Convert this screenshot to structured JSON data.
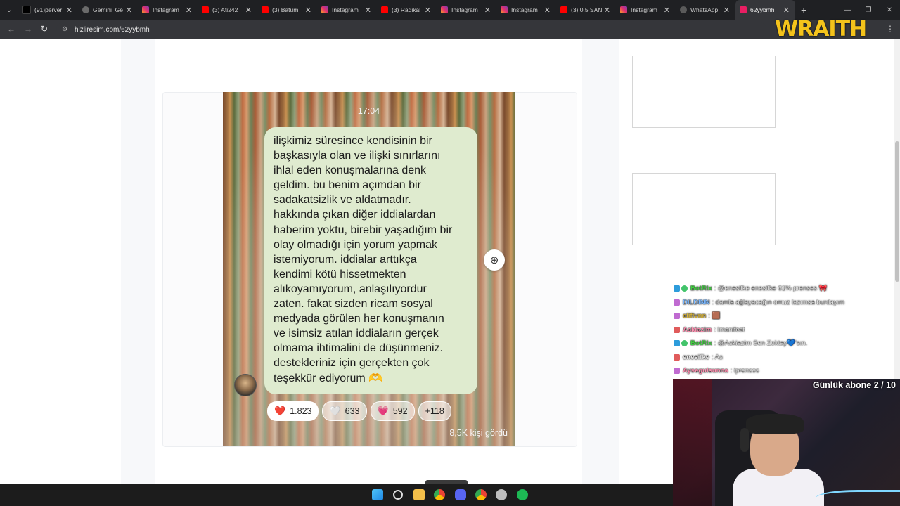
{
  "tabs": [
    {
      "label": "(91)perver",
      "icon": "tiktok-icon"
    },
    {
      "label": "Gemini_Ge",
      "icon": "globe-icon"
    },
    {
      "label": "Instagram",
      "icon": "instagram-icon"
    },
    {
      "label": "(3) Ati242",
      "icon": "youtube-icon"
    },
    {
      "label": "(3) Batum",
      "icon": "youtube-icon"
    },
    {
      "label": "Instagram",
      "icon": "instagram-icon"
    },
    {
      "label": "(3) Radikal",
      "icon": "youtube-icon"
    },
    {
      "label": "Instagram",
      "icon": "instagram-icon"
    },
    {
      "label": "Instagram",
      "icon": "instagram-icon"
    },
    {
      "label": "(3) 0.5 SAN",
      "icon": "youtube-icon"
    },
    {
      "label": "Instagram",
      "icon": "instagram-icon"
    },
    {
      "label": "WhatsApp",
      "icon": "whatsapp-icon"
    },
    {
      "label": "62yybmh",
      "icon": "hizliresim-icon",
      "active": true
    }
  ],
  "address_bar": {
    "url": "hizliresim.com/62yybmh"
  },
  "overlay_logo": {
    "text": "WRAITH"
  },
  "story": {
    "time": "17:04",
    "message_lines": [
      "ilişkimiz süresince kendisinin bir",
      "başkasıyla olan ve ilişki sınırlarını",
      "ihlal eden konuşmalarına denk",
      "geldim. bu benim açımdan bir",
      "sadakatsizlik ve aldatmadır.",
      "hakkında çıkan diğer iddialardan",
      "haberim yoktu, birebir yaşadığım bir",
      "olay olmadığı için yorum yapmak",
      "istemiyorum. iddialar arttıkça",
      "kendimi kötü hissetmekten",
      "alıkoyamıyorum, anlaşılıyordur",
      "zaten. fakat sizden ricam sosyal",
      "medyada görülen her konuşmanın",
      "ve isimsiz atılan iddiaların gerçek",
      "olmama ihtimalini de düşünmeniz.",
      "destekleriniz için gerçekten çok",
      "teşekkür ediyorum 🫶"
    ],
    "reactions": [
      {
        "emoji": "❤️",
        "count": "1.823"
      },
      {
        "emoji": "🤍",
        "count": "633"
      },
      {
        "emoji": "💗",
        "count": "592"
      },
      {
        "emoji": "",
        "count": "+118"
      }
    ],
    "views": "8,5K kişi gördü"
  },
  "stream_chat": [
    {
      "badges": [
        "mod",
        "ok"
      ],
      "user": "BotRix",
      "user_color": "#3fd13f",
      "text": ": @enesifke enesifke 61% prenses 🎀"
    },
    {
      "badges": [
        "sub"
      ],
      "user": "DILDINN",
      "user_color": "#7ab8ff",
      "text": ": damla ağlayacağın omuz lazımsa burdayım"
    },
    {
      "badges": [
        "sub"
      ],
      "user": "elifivnn",
      "user_color": "#d6b33a",
      "text": ": 🟫"
    },
    {
      "badges": [
        "sub2"
      ],
      "user": "Askiazim",
      "user_color": "#ff8fb0",
      "text": ": Imanifest"
    },
    {
      "badges": [
        "mod",
        "ok"
      ],
      "user": "BotRix",
      "user_color": "#3fd13f",
      "text": ": @Askiazim Sen Zoktay💙'sın."
    },
    {
      "badges": [
        "sub2"
      ],
      "user": "enesifke",
      "user_color": "#e9e9e9",
      "text": ": As"
    },
    {
      "badges": [
        "sub"
      ],
      "user": "Aysegulsunna",
      "user_color": "#ff8fb0",
      "text": ": iprenses"
    }
  ],
  "webcam": {
    "goal_text": "Günlük abone 2 / 10"
  }
}
